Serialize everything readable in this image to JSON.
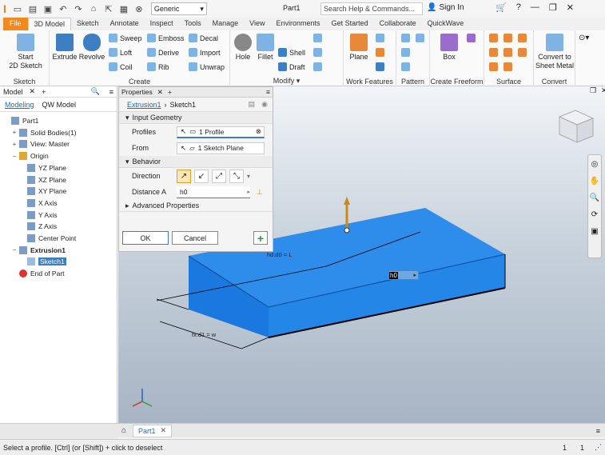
{
  "app": {
    "document_title": "Part1",
    "appearance_preset": "Generic",
    "search_placeholder": "Search Help & Commands...",
    "sign_in": "Sign In"
  },
  "ribbon_tabs": [
    "File",
    "3D Model",
    "Sketch",
    "Annotate",
    "Inspect",
    "Tools",
    "Manage",
    "View",
    "Environments",
    "Get Started",
    "Collaborate",
    "QuickWave"
  ],
  "ribbon": {
    "sketch": {
      "start_sketch": "Start\n2D Sketch",
      "label": "Sketch"
    },
    "create": {
      "extrude": "Extrude",
      "revolve": "Revolve",
      "sweep": "Sweep",
      "emboss": "Emboss",
      "decal": "Decal",
      "loft": "Loft",
      "derive": "Derive",
      "import": "Import",
      "coil": "Coil",
      "rib": "Rib",
      "unwrap": "Unwrap",
      "label": "Create"
    },
    "modify": {
      "hole": "Hole",
      "fillet": "Fillet",
      "shell": "Shell",
      "draft": "Draft",
      "label": "Modify"
    },
    "work_features": {
      "plane": "Plane",
      "label": "Work Features"
    },
    "pattern": {
      "label": "Pattern"
    },
    "freeform": {
      "box": "Box",
      "label": "Create Freeform"
    },
    "surface": {
      "label": "Surface"
    },
    "convert": {
      "sheet_metal": "Convert to\nSheet Metal",
      "label": "Convert"
    }
  },
  "browser": {
    "title": "Model",
    "tabs": [
      "Modeling",
      "QW Model"
    ],
    "tree": [
      {
        "label": "Part1",
        "indent": 0,
        "exp": ""
      },
      {
        "label": "Solid Bodies(1)",
        "indent": 1,
        "exp": "+"
      },
      {
        "label": "View: Master",
        "indent": 1,
        "exp": "+"
      },
      {
        "label": "Origin",
        "indent": 1,
        "exp": "−"
      },
      {
        "label": "YZ Plane",
        "indent": 2,
        "exp": ""
      },
      {
        "label": "XZ Plane",
        "indent": 2,
        "exp": ""
      },
      {
        "label": "XY Plane",
        "indent": 2,
        "exp": ""
      },
      {
        "label": "X Axis",
        "indent": 2,
        "exp": ""
      },
      {
        "label": "Y Axis",
        "indent": 2,
        "exp": ""
      },
      {
        "label": "Z Axis",
        "indent": 2,
        "exp": ""
      },
      {
        "label": "Center Point",
        "indent": 2,
        "exp": ""
      },
      {
        "label": "Extrusion1",
        "indent": 1,
        "exp": "−"
      },
      {
        "label": "Sketch1",
        "indent": 2,
        "exp": ""
      },
      {
        "label": "End of Part",
        "indent": 1,
        "exp": ""
      }
    ]
  },
  "properties": {
    "title": "Properties",
    "feature": "Extrusion1",
    "sketch": "Sketch1",
    "input_geometry": "Input Geometry",
    "profiles_label": "Profiles",
    "profiles_value": "1 Profile",
    "from_label": "From",
    "from_value": "1 Sketch Plane",
    "behavior": "Behavior",
    "direction_label": "Direction",
    "distance_label": "Distance A",
    "distance_value": "h0",
    "advanced": "Advanced Properties",
    "ok": "OK",
    "cancel": "Cancel"
  },
  "viewport": {
    "dim_length": "hd:d0 = L",
    "dim_width": "fx:d1 = w",
    "input_value": "h0"
  },
  "doc_tab": "Part1",
  "status": {
    "message": "Select a profile. [Ctrl] (or [Shift]) + click to deselect",
    "count1": "1",
    "count2": "1"
  }
}
